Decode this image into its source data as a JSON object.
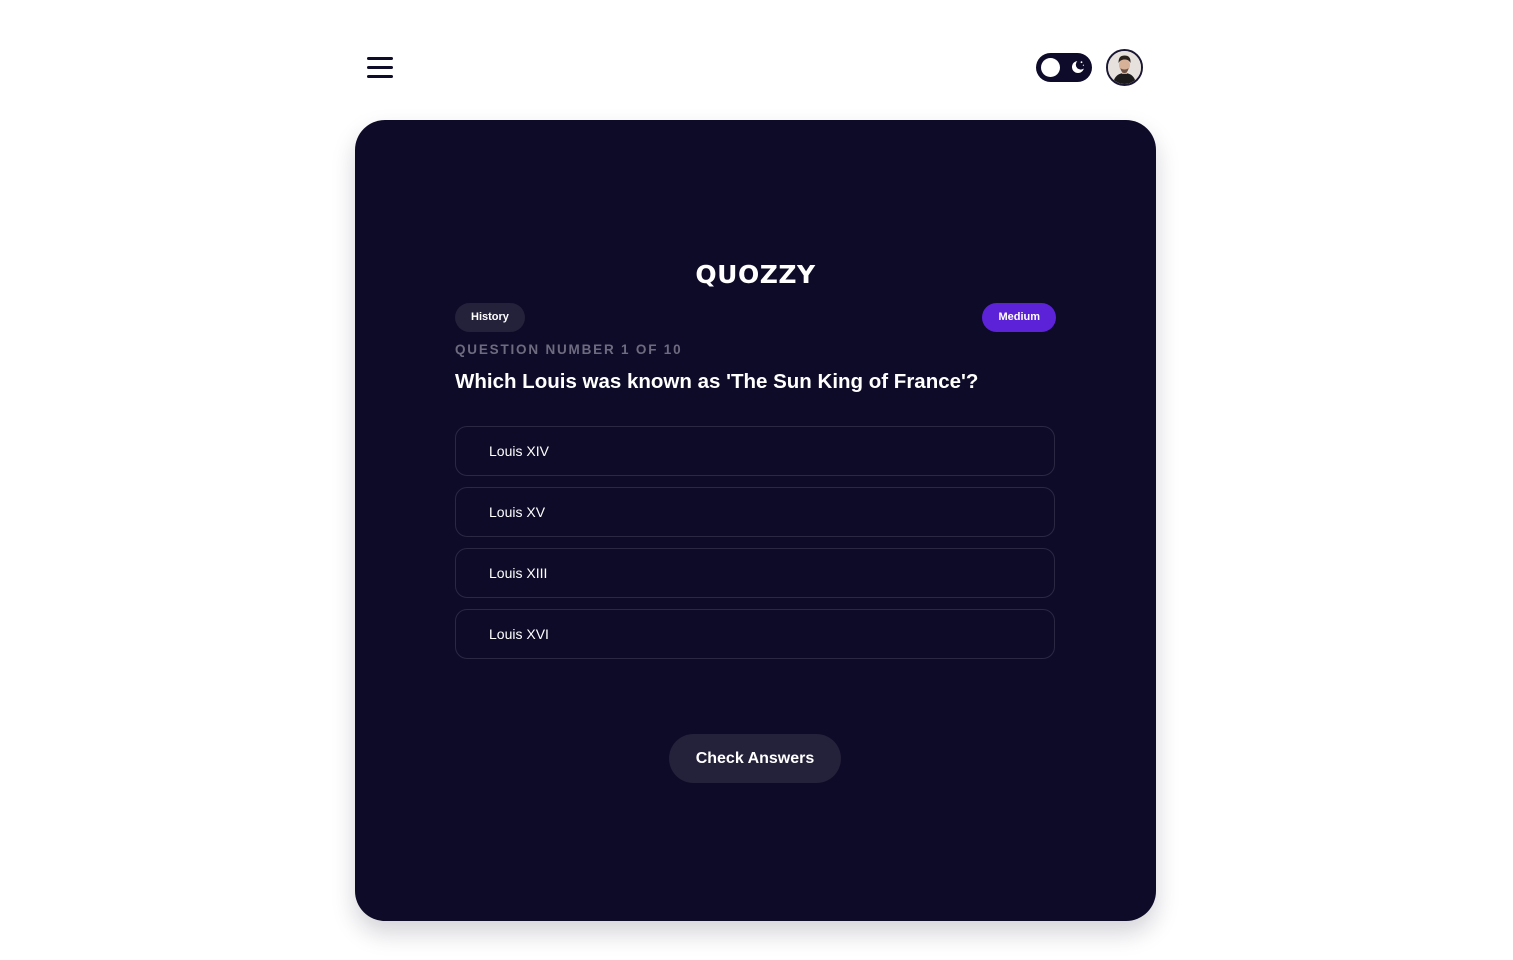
{
  "header": {
    "menu_icon": "hamburger-menu-icon",
    "theme_toggle": {
      "icon": "moon-icon",
      "mode": "dark"
    },
    "avatar_icon": "user-avatar"
  },
  "quiz": {
    "brand": "QUOZZY",
    "category": "History",
    "difficulty": "Medium",
    "question_counter": "QUESTION NUMBER 1 OF 10",
    "question": "Which Louis was known as 'The Sun King of France'?",
    "options": [
      {
        "label": "Louis XIV"
      },
      {
        "label": "Louis XV"
      },
      {
        "label": "Louis XIII"
      },
      {
        "label": "Louis XVI"
      }
    ],
    "check_label": "Check Answers"
  },
  "colors": {
    "card_background": "#0e0b28",
    "difficulty_badge": "#5c22d8",
    "category_badge": "#24213a",
    "button_background": "#24213a"
  }
}
